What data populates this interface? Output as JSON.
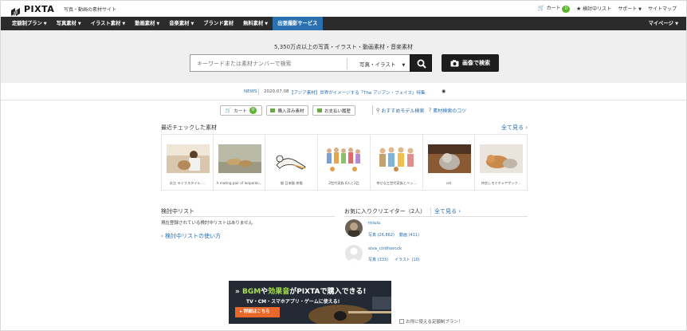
{
  "header": {
    "logo_text": "PIXTA",
    "tagline": "写真・動画の素材サイト",
    "cart_label": "カート",
    "cart_count": "0",
    "wishlist_label": "検討中リスト",
    "support_label": "サポート",
    "sitemap_label": "サイトマップ"
  },
  "nav": {
    "items": [
      {
        "label": "定額制プラン",
        "caret": true
      },
      {
        "label": "写真素材",
        "caret": true
      },
      {
        "label": "イラスト素材",
        "caret": true
      },
      {
        "label": "動画素材",
        "caret": true
      },
      {
        "label": "音楽素材",
        "caret": true
      },
      {
        "label": "ブランド素材",
        "caret": false
      },
      {
        "label": "無料素材",
        "caret": true
      },
      {
        "label": "出張撮影サービス",
        "caret": false
      }
    ],
    "mypage_label": "マイページ"
  },
  "search": {
    "caption": "5,350万点以上の写真・イラスト・動画素材・音楽素材",
    "placeholder": "キーワードまたは素材ナンバーで検索",
    "type_selected": "写真・イラスト",
    "image_search_label": "画像で検索"
  },
  "news": {
    "label": "NEWS",
    "date": "2020.07.08",
    "text": "【アジア素材】世界がイメージする「The アジアン・フェイス」特集"
  },
  "quick": {
    "cart_label": "カート",
    "cart_count": "0",
    "purchased_label": "購入済み素材",
    "payment_label": "お支払い履歴",
    "model_search_label": "おすすめモデル検索",
    "tips_label": "素材検索のコツ"
  },
  "recent": {
    "title": "最近チェックした素材",
    "view_all": "全て見る",
    "items": [
      {
        "caption": "炎注 ライフスタイル ..."
      },
      {
        "caption": "A mating pair of leopards..."
      },
      {
        "caption": "猫 日本猫 茶猫"
      },
      {
        "caption": "2世代家族 6人と2匹"
      },
      {
        "caption": "幸せな三世代家族とペッ..."
      },
      {
        "caption": "cat"
      },
      {
        "caption": "仲良しモミチャアザック..."
      }
    ]
  },
  "wishlist": {
    "title": "検討中リスト",
    "empty_text": "現在登録されている検討中リストはありません",
    "howto_link": "検討中リストの使い方"
  },
  "favorites": {
    "title": "お気に入りクリエイター（2人）",
    "view_all": "全て見る",
    "creators": [
      {
        "name": "miuiu",
        "photos": "写真 (26,862)",
        "videos": "動画 (411)"
      },
      {
        "name": "siva_cinthercck",
        "photos": "写真 (333)",
        "videos": "イラスト (10)"
      }
    ]
  },
  "banner": {
    "line1_a": "BGM",
    "line1_b": "や",
    "line1_c": "効果音",
    "line1_d": "がPIXTAで購入できる!",
    "line2": "TV・CM・スマホアプリ・ゲームに使える!",
    "button": "詳細はこちら",
    "broken_image_alt": "お得に使える定額制プラン！"
  },
  "colors": {
    "accent_blue": "#2a6fb0",
    "nav_bg": "#2b2b2b",
    "badge_green": "#5cb531",
    "banner_orange": "#e8672a"
  }
}
